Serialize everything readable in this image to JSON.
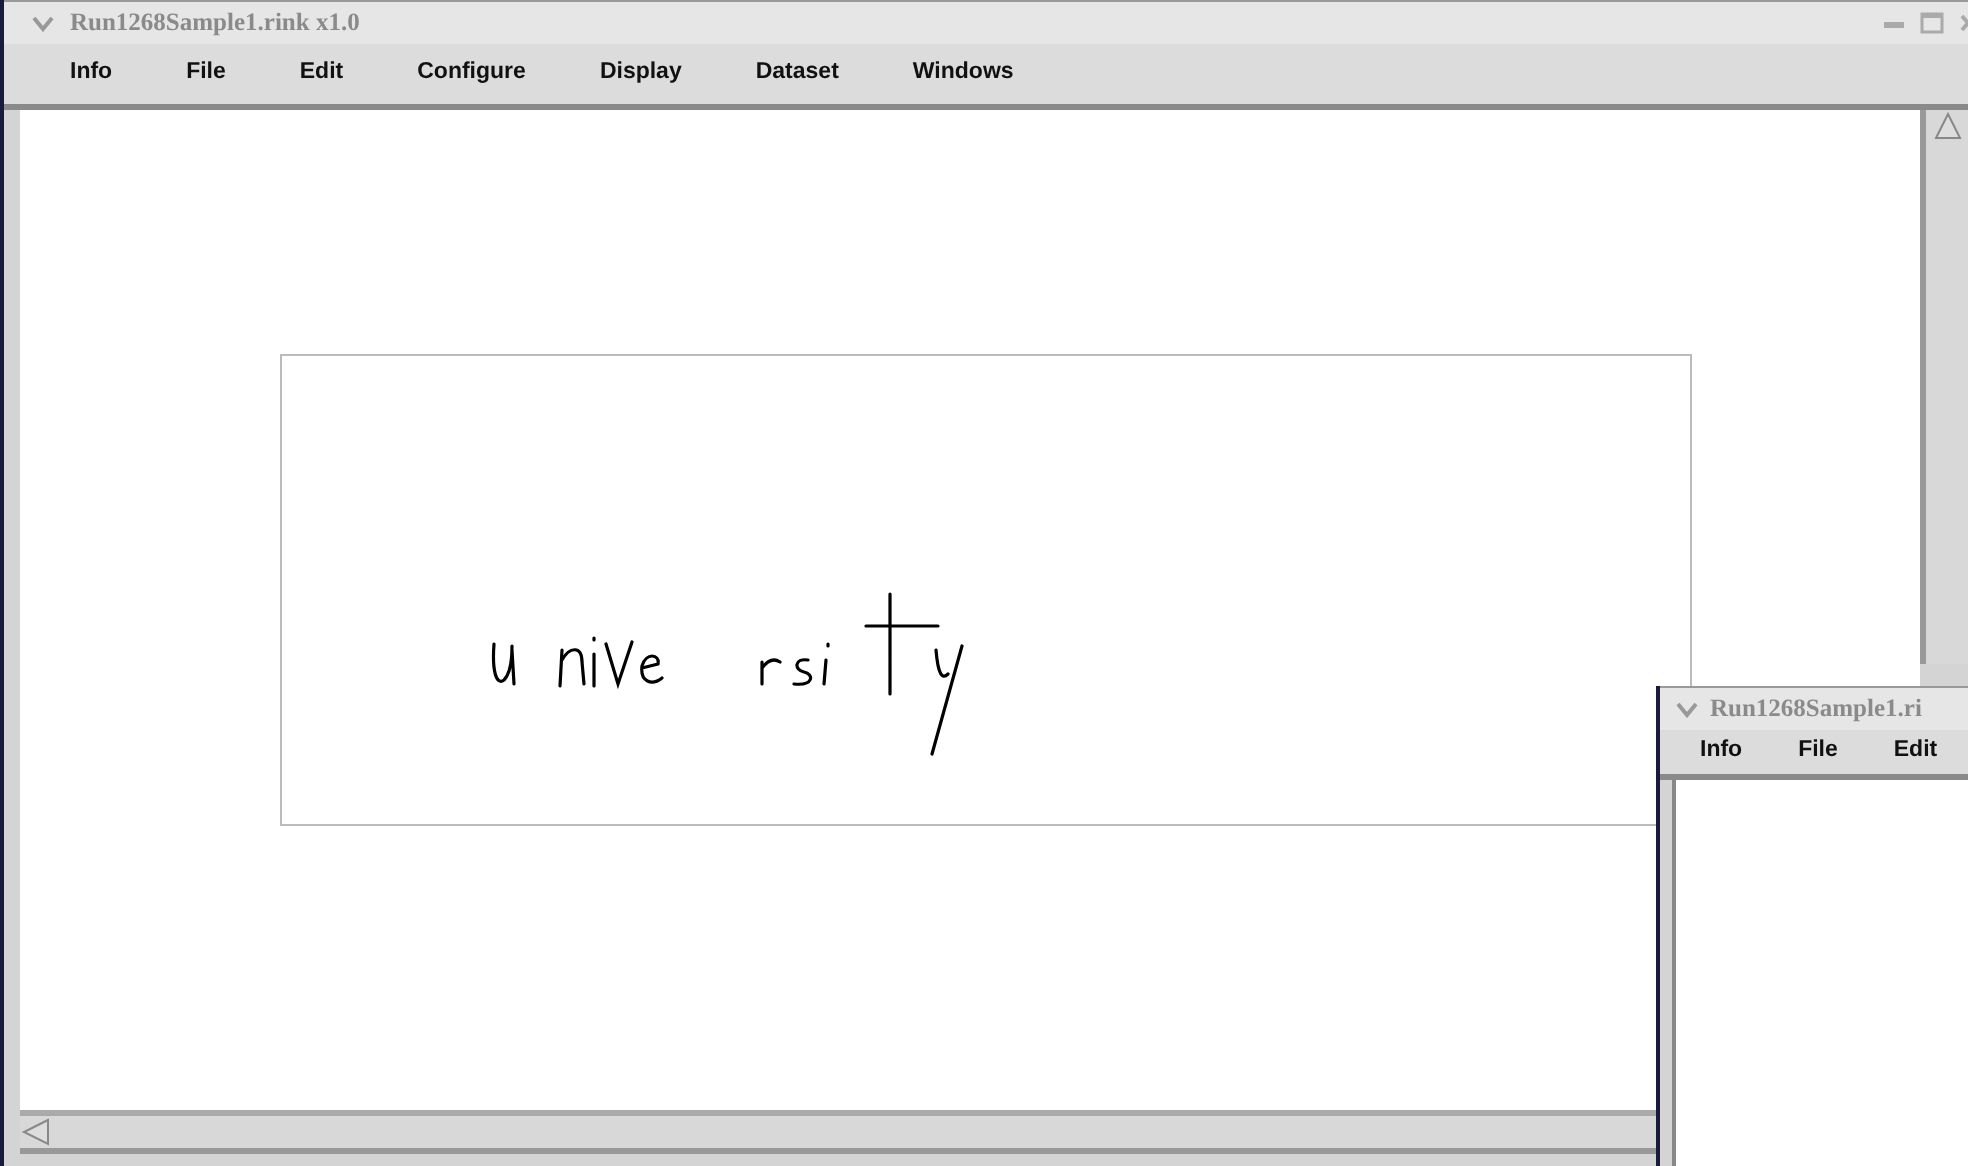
{
  "windows": [
    {
      "title": "Run1268Sample1.rink x1.0",
      "menu": [
        "Info",
        "File",
        "Edit",
        "Configure",
        "Display",
        "Dataset",
        "Windows"
      ]
    },
    {
      "title": "Run1268Sample1.ri",
      "menu": [
        "Info",
        "File",
        "Edit"
      ]
    }
  ]
}
